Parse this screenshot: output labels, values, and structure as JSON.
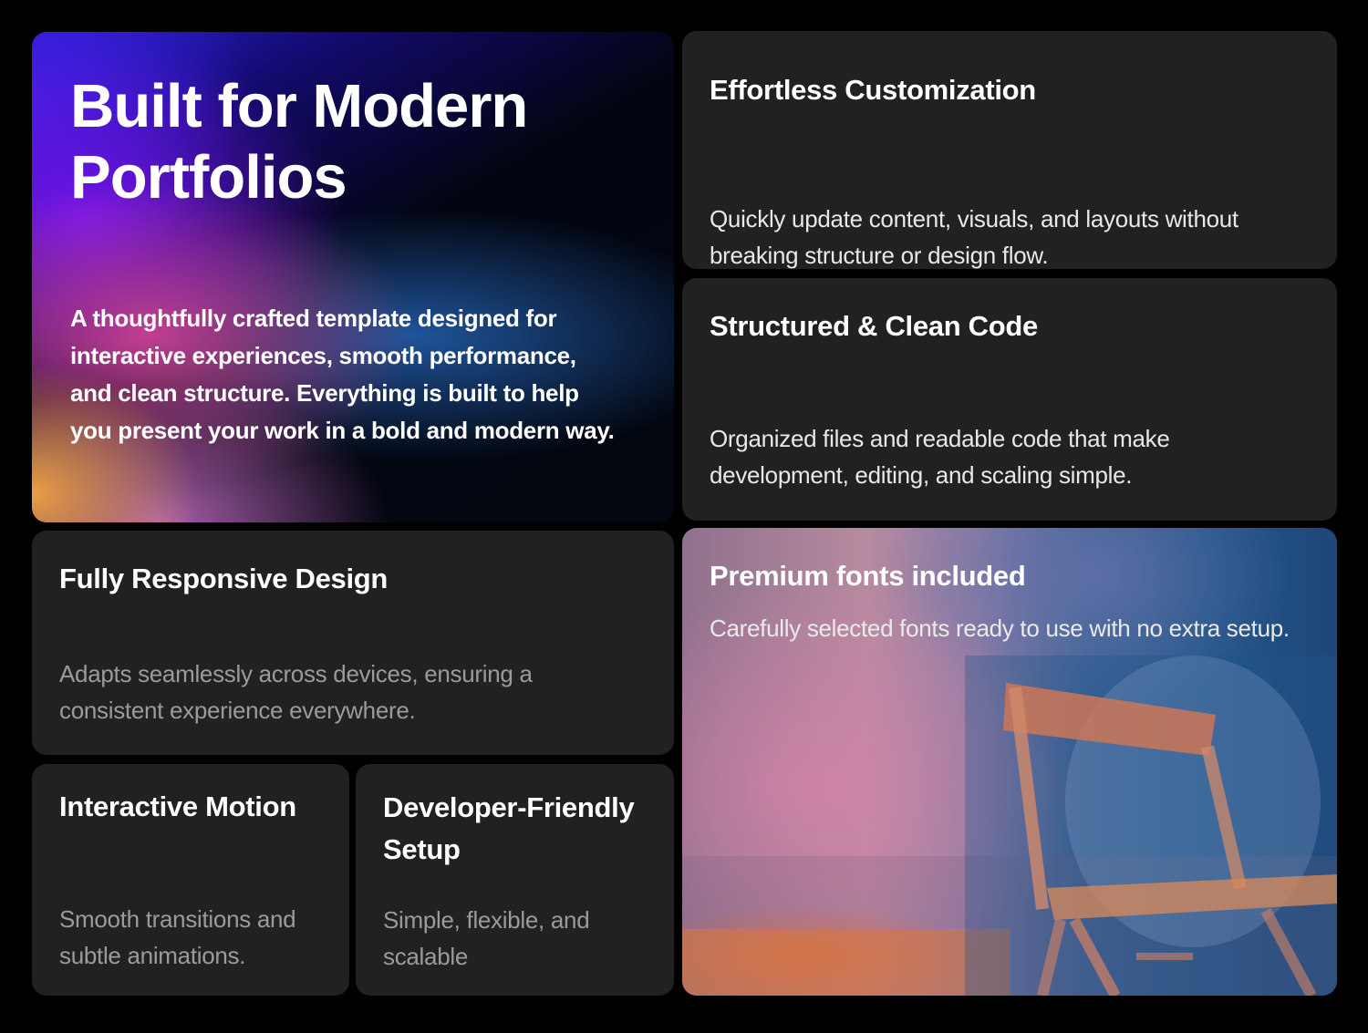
{
  "hero": {
    "title_line1": "Built for Modern",
    "title_line2": "Portfolios",
    "description": "A thoughtfully crafted template designed for interactive experiences, smooth performance, and clean structure. Everything is built to help you present your work in a bold and modern way."
  },
  "features": {
    "customization": {
      "title": "Effortless Customization",
      "description": "Quickly update content, visuals, and layouts without breaking structure or design flow."
    },
    "code": {
      "title": "Structured & Clean Code",
      "description": "Organized files and readable code that make development, editing, and scaling simple."
    },
    "responsive": {
      "title": "Fully Responsive Design",
      "description": "Adapts seamlessly across devices, ensuring a consistent experience everywhere."
    },
    "motion": {
      "title": "Interactive Motion",
      "description": "Smooth transitions and subtle animations."
    },
    "setup": {
      "title": "Developer-Friendly Setup",
      "description": "Simple, flexible, and scalable"
    },
    "fonts": {
      "title": "Premium fonts included",
      "description": "Carefully selected fonts ready to use with no extra setup."
    }
  },
  "colors": {
    "background": "#000000",
    "card": "#212121",
    "heading": "#ffffff",
    "muted_text": "#9b9b9b"
  }
}
